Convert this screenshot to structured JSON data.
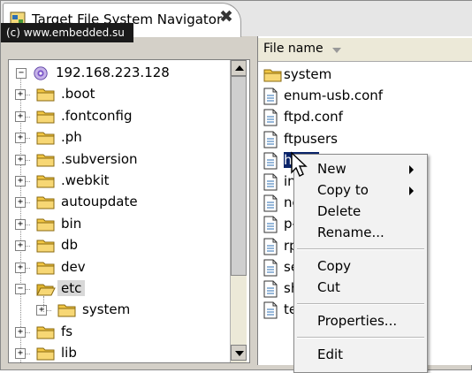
{
  "watermark": "(c) www.embedded.su",
  "tab": {
    "title": "Target File System Navigator",
    "close_glyph": "✖"
  },
  "tree": {
    "root": {
      "label": "192.168.223.128",
      "expander": "−"
    },
    "items": [
      {
        "label": ".boot",
        "expander": "+"
      },
      {
        "label": ".fontconfig",
        "expander": "+"
      },
      {
        "label": ".ph",
        "expander": "+"
      },
      {
        "label": ".subversion",
        "expander": "+"
      },
      {
        "label": ".webkit",
        "expander": "+"
      },
      {
        "label": "autoupdate",
        "expander": "+"
      },
      {
        "label": "bin",
        "expander": "+"
      },
      {
        "label": "db",
        "expander": "+"
      },
      {
        "label": "dev",
        "expander": "+"
      },
      {
        "label": "etc",
        "expander": "−",
        "selected": true,
        "open": true
      },
      {
        "label": "system",
        "expander": "+",
        "child": true
      },
      {
        "label": "fs",
        "expander": "+"
      },
      {
        "label": "lib",
        "expander": "+"
      }
    ]
  },
  "file_list": {
    "header": "File name",
    "items": [
      {
        "label": "system",
        "type": "folder"
      },
      {
        "label": "enum-usb.conf",
        "type": "file"
      },
      {
        "label": "ftpd.conf",
        "type": "file"
      },
      {
        "label": "ftpusers",
        "type": "file"
      },
      {
        "label": "hosts",
        "type": "file",
        "selected": true
      },
      {
        "label": "in",
        "type": "file"
      },
      {
        "label": "ne",
        "type": "file"
      },
      {
        "label": "p-",
        "type": "file"
      },
      {
        "label": "rp",
        "type": "file"
      },
      {
        "label": "se",
        "type": "file"
      },
      {
        "label": "sh",
        "type": "file"
      },
      {
        "label": "te",
        "type": "file"
      }
    ]
  },
  "context_menu": {
    "new": "New",
    "copy_to": "Copy to",
    "delete": "Delete",
    "rename": "Rename...",
    "copy": "Copy",
    "cut": "Cut",
    "properties": "Properties...",
    "edit": "Edit"
  },
  "colors": {
    "selection": "#0a246a",
    "folder": "#f2c744",
    "tree_selected": "#d8d8d8"
  }
}
